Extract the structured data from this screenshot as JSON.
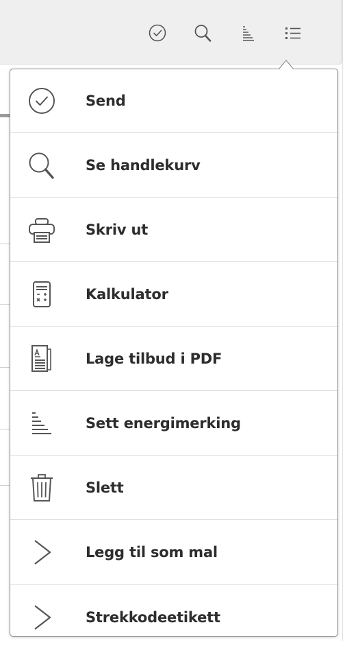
{
  "toolbar": {
    "buttons": [
      {
        "icon": "check-circle-icon"
      },
      {
        "icon": "search-icon"
      },
      {
        "icon": "energy-label-icon"
      },
      {
        "icon": "list-icon"
      }
    ]
  },
  "menu": {
    "items": [
      {
        "label": "Send",
        "icon": "check-circle-icon"
      },
      {
        "label": "Se handlekurv",
        "icon": "search-icon"
      },
      {
        "label": "Skriv ut",
        "icon": "printer-icon"
      },
      {
        "label": "Kalkulator",
        "icon": "calculator-icon"
      },
      {
        "label": "Lage tilbud i PDF",
        "icon": "pdf-document-icon"
      },
      {
        "label": "Sett energimerking",
        "icon": "energy-label-icon"
      },
      {
        "label": "Slett",
        "icon": "trash-icon"
      },
      {
        "label": "Legg til som mal",
        "icon": "chevron-right-icon"
      },
      {
        "label": "Strekkodeetikett",
        "icon": "chevron-right-icon"
      }
    ]
  },
  "colors": {
    "icon": "#555555",
    "label": "#2d2d2d",
    "toolbar_bg": "#efefef",
    "menu_border": "#8f8f8f",
    "separator": "#dcdcdc"
  }
}
